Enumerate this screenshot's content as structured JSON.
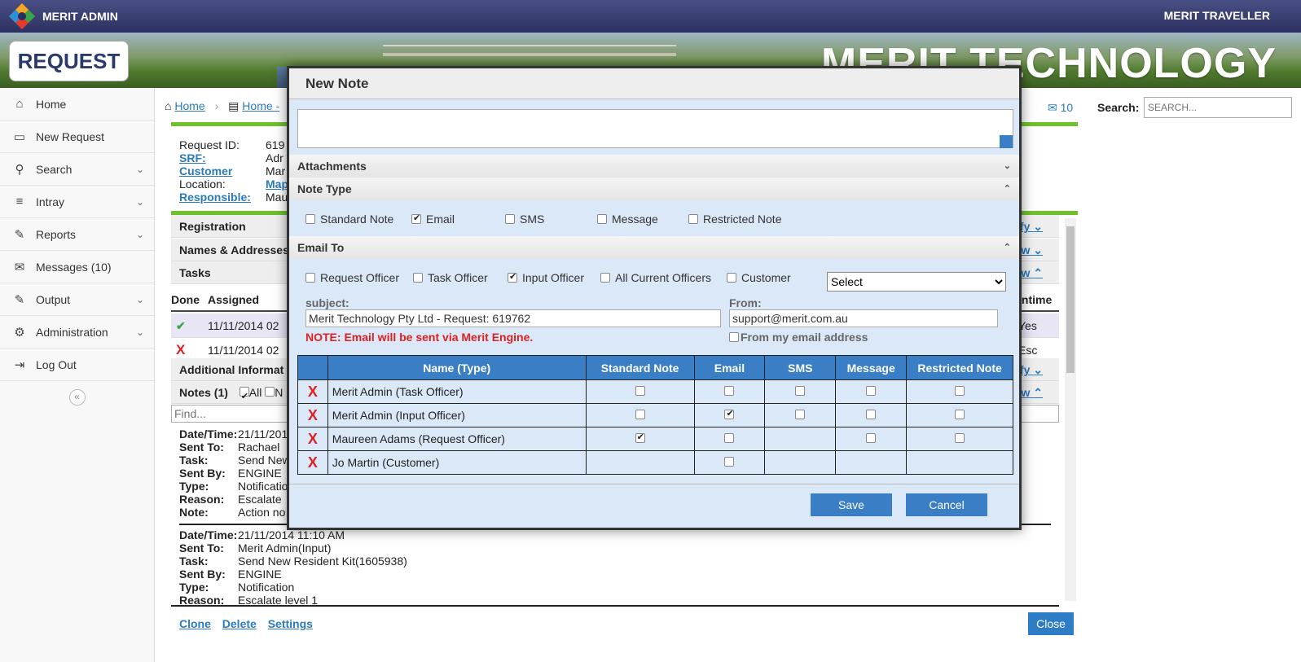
{
  "app": {
    "brand": "MERIT ADMIN",
    "right_link": "MERIT TRAVELLER",
    "banner_title": "MERIT TECHNOLOGY",
    "page_badge": "REQUEST"
  },
  "sidebar": {
    "items": [
      {
        "label": "Home",
        "icon": "home-icon",
        "chev": false
      },
      {
        "label": "New Request",
        "icon": "monitor-icon",
        "chev": false
      },
      {
        "label": "Search",
        "icon": "search-icon",
        "chev": true
      },
      {
        "label": "Intray",
        "icon": "list-icon",
        "chev": true
      },
      {
        "label": "Reports",
        "icon": "edit-icon",
        "chev": true
      },
      {
        "label": "Messages (10)",
        "icon": "envelope-icon",
        "chev": false
      },
      {
        "label": "Output",
        "icon": "edit-icon",
        "chev": true
      },
      {
        "label": "Administration",
        "icon": "gears-icon",
        "chev": true
      },
      {
        "label": "Log Out",
        "icon": "logout-icon",
        "chev": false
      }
    ],
    "collapse": "«"
  },
  "breadcrumb": {
    "home": "Home",
    "second": "Home -",
    "sep": "›"
  },
  "header": {
    "messages_count": "10",
    "search_label": "Search:",
    "search_placeholder": "SEARCH..."
  },
  "request": {
    "id_label": "Request ID:",
    "id_value": "619",
    "srf_label": "SRF:",
    "srf_value": "Adr",
    "customer_label": "Customer",
    "customer_value": "Mar",
    "location_label": "Location:",
    "location_value": "Map",
    "responsible_label": "Responsible:",
    "responsible_value": "Mau"
  },
  "sections": {
    "registration": "Registration",
    "registration_link": "dify",
    "names": "Names & Addresses",
    "names_link": "New",
    "tasks": "Tasks",
    "tasks_link": "New",
    "additional": "Additional Informat",
    "additional_link": "dify",
    "notes": "Notes (1)",
    "notes_all": "All",
    "notes_n": "N",
    "notes_link": "New"
  },
  "tasks_table": {
    "headers": {
      "done": "Done",
      "assigned": "Assigned",
      "intime": "Intime"
    },
    "rows": [
      {
        "mark": "✔",
        "assigned": "11/11/2014 02",
        "intime": "Yes"
      },
      {
        "mark": "X",
        "assigned": "11/11/2014 02",
        "intime": "Esc"
      }
    ]
  },
  "notes_find_placeholder": "Find...",
  "notes": [
    {
      "datetime": "21/11/201",
      "sent_to": "Rachael",
      "task": "Send New",
      "sent_by": "ENGINE",
      "type": "Notificatio",
      "reason": "Escalate",
      "note": "Action no"
    },
    {
      "datetime": "21/11/2014 11:10 AM",
      "sent_to": "Merit Admin(Input)",
      "task": "Send New Resident Kit(1605938)",
      "sent_by": "ENGINE",
      "type": "Notification",
      "reason": "Escalate level 1"
    }
  ],
  "note_labels": {
    "datetime": "Date/Time:",
    "sent_to": "Sent To:",
    "task": "Task:",
    "sent_by": "Sent By:",
    "type": "Type:",
    "reason": "Reason:",
    "note": "Note:"
  },
  "footer": {
    "clone": "Clone",
    "delete": "Delete",
    "settings": "Settings",
    "close": "Close"
  },
  "modal": {
    "title": "New Note",
    "attachments": "Attachments",
    "note_type": "Note Type",
    "note_types": [
      {
        "label": "Standard Note",
        "checked": false
      },
      {
        "label": "Email",
        "checked": true
      },
      {
        "label": "SMS",
        "checked": false
      },
      {
        "label": "Message",
        "checked": false
      },
      {
        "label": "Restricted Note",
        "checked": false
      }
    ],
    "email_to": "Email To",
    "email_targets": [
      {
        "label": "Request Officer",
        "checked": false
      },
      {
        "label": "Task Officer",
        "checked": false
      },
      {
        "label": "Input Officer",
        "checked": true
      },
      {
        "label": "All Current Officers",
        "checked": false
      },
      {
        "label": "Customer",
        "checked": false
      }
    ],
    "select_value": "Select",
    "subject_label": "subject:",
    "subject_value": "Merit Technology Pty Ltd - Request: 619762",
    "from_label": "From:",
    "from_value": "support@merit.com.au",
    "from_mine": "From my email address",
    "warning": "NOTE: Email will be sent via Merit Engine.",
    "table": {
      "headers": [
        "",
        "Name (Type)",
        "Standard Note",
        "Email",
        "SMS",
        "Message",
        "Restricted Note"
      ],
      "rows": [
        {
          "name": "Merit Admin (Task Officer)",
          "cells": [
            "off",
            "off",
            "off",
            "off",
            "off"
          ]
        },
        {
          "name": "Merit Admin (Input Officer)",
          "cells": [
            "off",
            "on",
            "off",
            "off",
            "off"
          ]
        },
        {
          "name": "Maureen Adams (Request Officer)",
          "cells": [
            "on",
            "off",
            "none",
            "off",
            "off"
          ]
        },
        {
          "name": "Jo Martin (Customer)",
          "cells": [
            "none",
            "off",
            "none",
            "none",
            "none"
          ]
        }
      ]
    },
    "save": "Save",
    "cancel": "Cancel"
  },
  "colors": {
    "accent": "#3a7fc5",
    "green": "#6ec12b",
    "danger": "#e02020",
    "modal_bg": "#dbe8f8"
  }
}
